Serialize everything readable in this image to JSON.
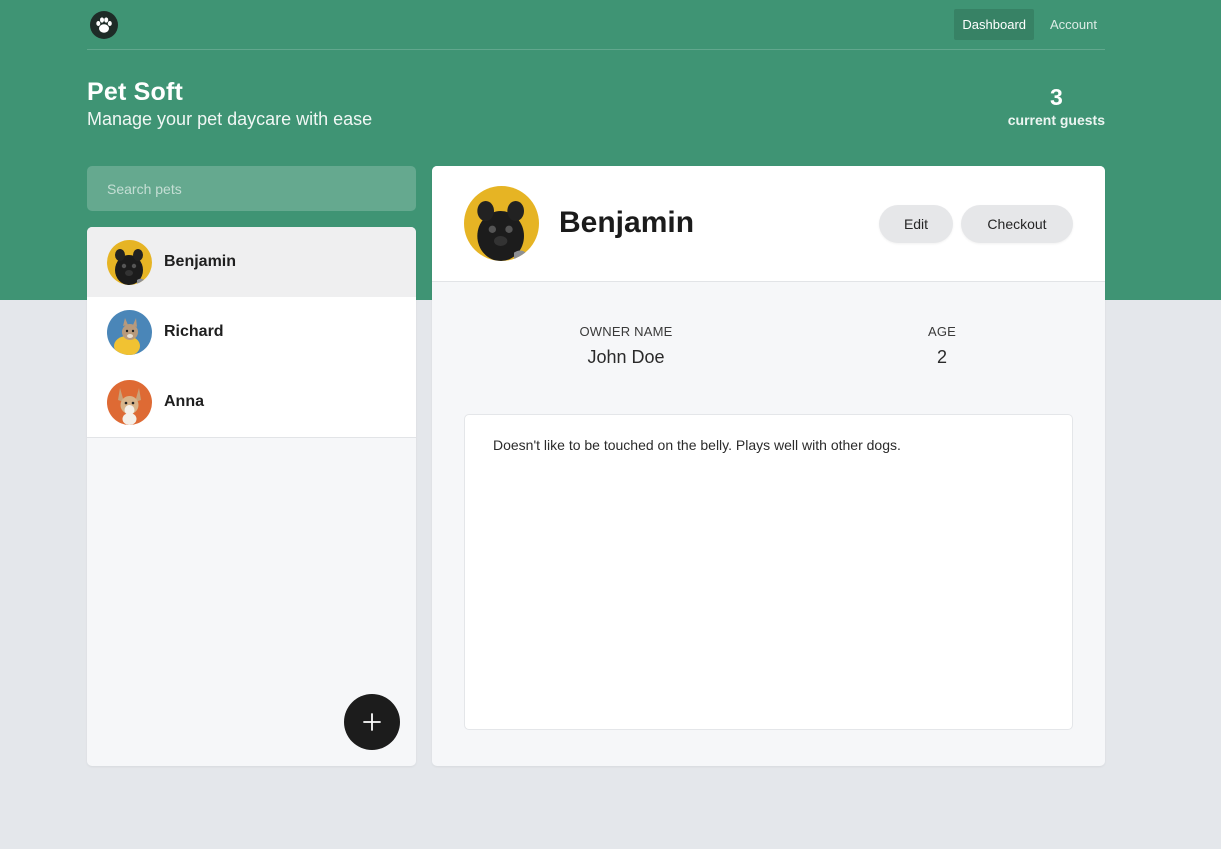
{
  "nav": {
    "logo": "paw-icon",
    "links": [
      {
        "label": "Dashboard",
        "active": true
      },
      {
        "label": "Account",
        "active": false
      }
    ]
  },
  "header": {
    "title": "Pet Soft",
    "subtitle": "Manage your pet daycare with ease",
    "guests_count": "3",
    "guests_label": "current guests"
  },
  "search": {
    "placeholder": "Search pets",
    "value": ""
  },
  "pets": [
    {
      "name": "Benjamin",
      "selected": true
    },
    {
      "name": "Richard",
      "selected": false
    },
    {
      "name": "Anna",
      "selected": false
    }
  ],
  "add_button": {
    "icon": "plus-icon"
  },
  "detail": {
    "name": "Benjamin",
    "edit_label": "Edit",
    "checkout_label": "Checkout",
    "owner_label": "OWNER NAME",
    "owner_value": "John Doe",
    "age_label": "AGE",
    "age_value": "2",
    "notes": "Doesn't like to be touched on the belly. Plays well with other dogs."
  },
  "colors": {
    "brand_green": "#3f9474",
    "page_bg": "#e4e7eb",
    "button_dark": "#1c1c1c"
  }
}
